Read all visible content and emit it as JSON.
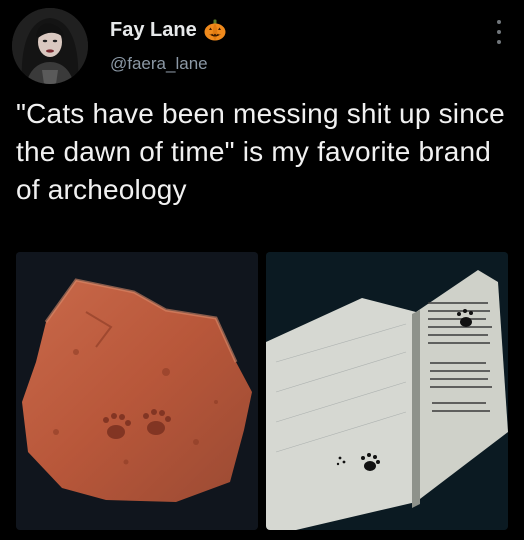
{
  "author": {
    "display_name": "Fay Lane",
    "handle": "@faera_lane",
    "name_emoji": "pumpkin-icon"
  },
  "tweet": {
    "text": "\"Cats have been messing shit up since the dawn of time\" is my favorite brand of archeology"
  },
  "media": [
    {
      "subject": "brick-with-cat-paw-prints",
      "icon": "photo"
    },
    {
      "subject": "manuscript-with-inky-cat-paw-prints",
      "icon": "photo"
    }
  ],
  "colors": {
    "background": "#000000",
    "text": "#e7e9ea",
    "secondary_text": "#8b98a5"
  }
}
